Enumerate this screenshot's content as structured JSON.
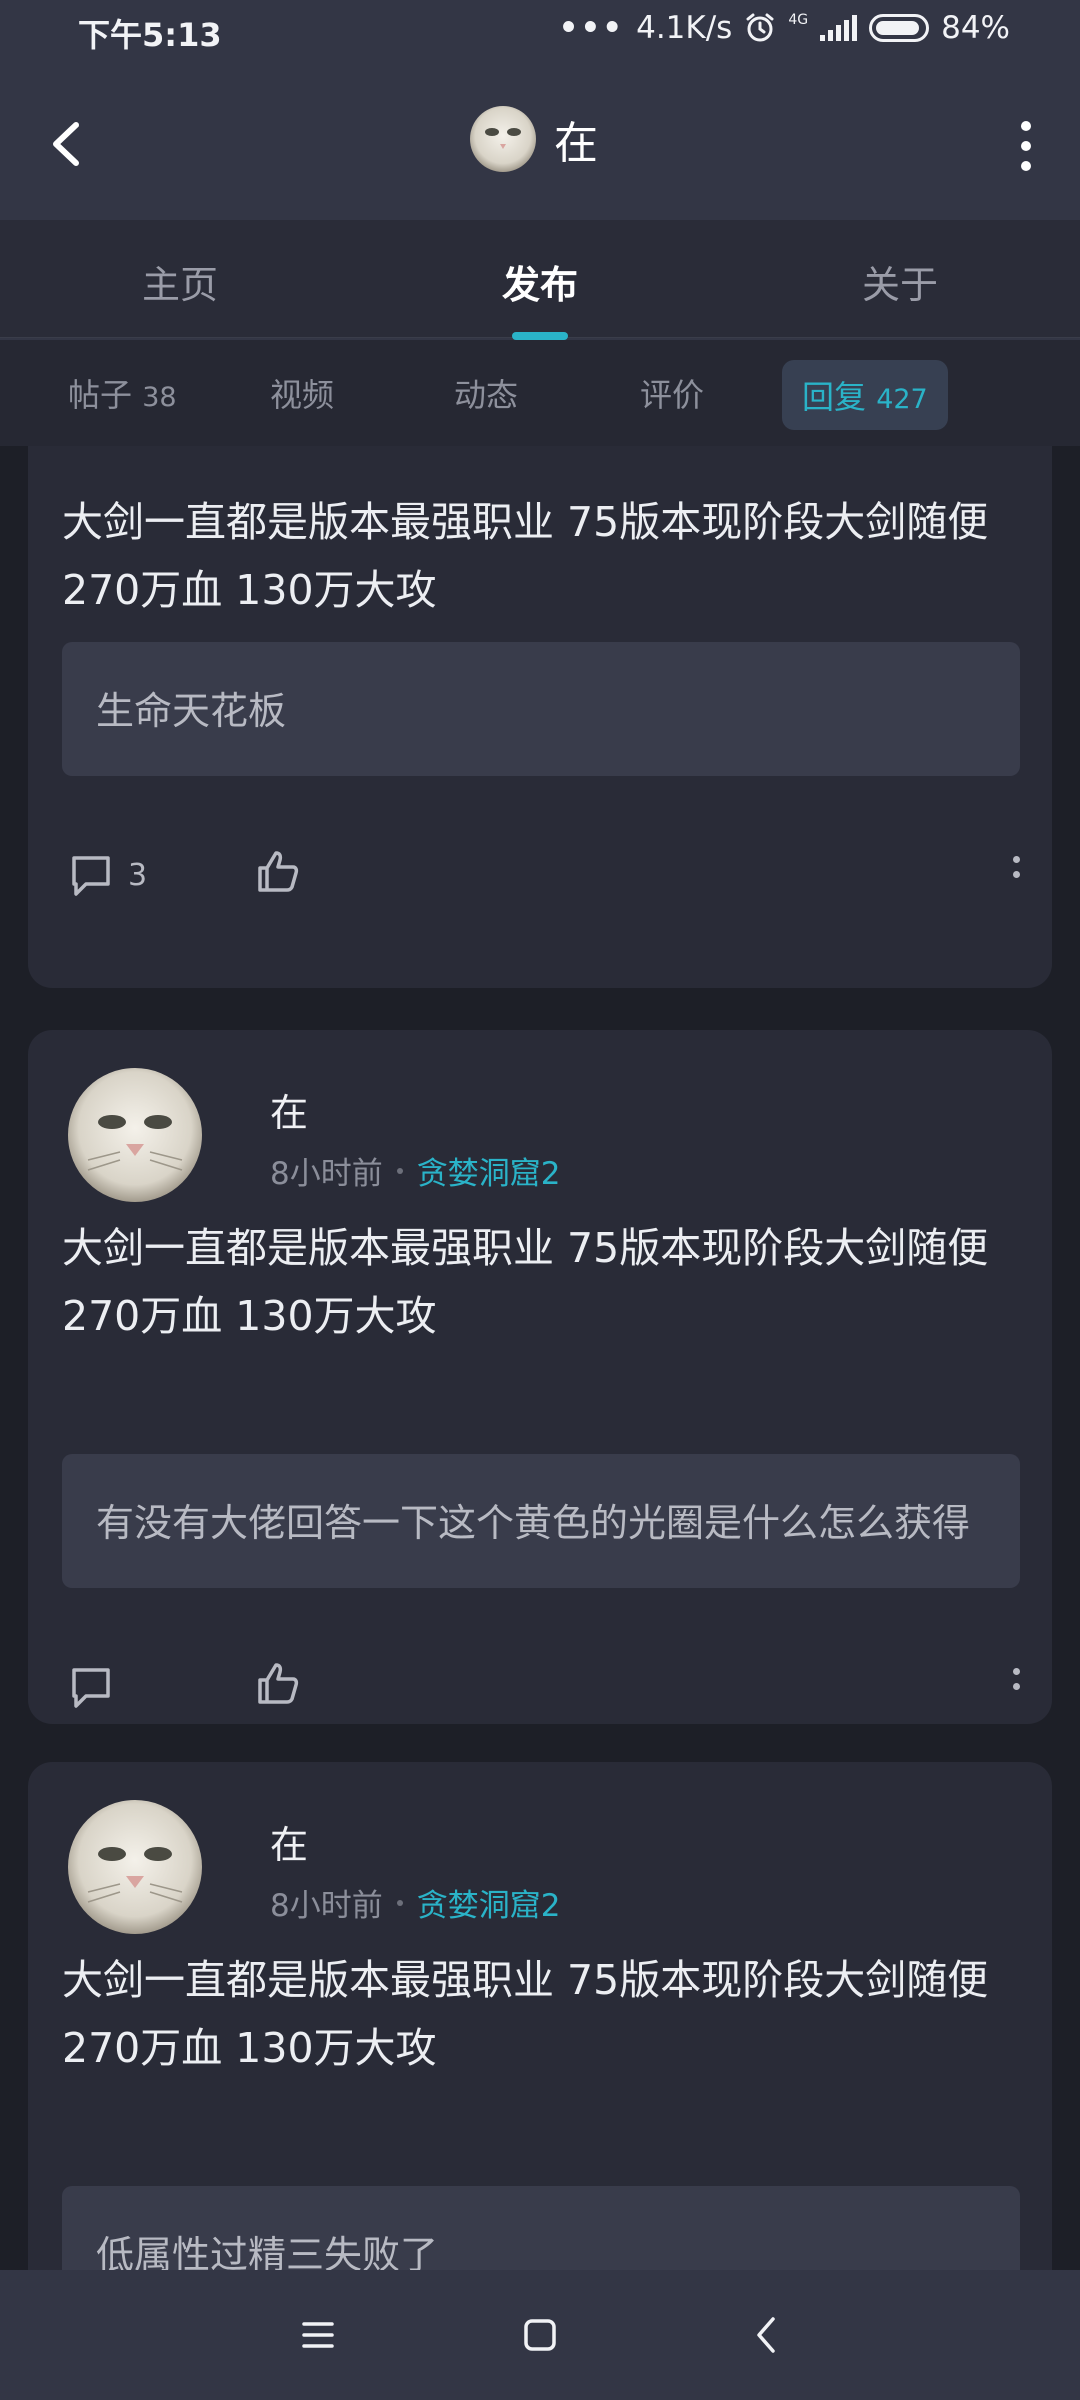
{
  "status_bar": {
    "time": "下午5:13",
    "net_speed": "4.1K/s",
    "network_type": "4G",
    "battery": "84%",
    "icons": [
      "alarm-icon",
      "signal-icon",
      "battery-icon"
    ]
  },
  "title_bar": {
    "title": "在",
    "icons": [
      "back-icon",
      "avatar",
      "more-vertical-icon"
    ]
  },
  "main_tabs": [
    {
      "label": "主页",
      "active": false
    },
    {
      "label": "发布",
      "active": true
    },
    {
      "label": "关于",
      "active": false
    }
  ],
  "sub_tabs": [
    {
      "label": "帖子",
      "count": "38",
      "active": false
    },
    {
      "label": "视频",
      "count": "",
      "active": false
    },
    {
      "label": "动态",
      "count": "",
      "active": false
    },
    {
      "label": "评价",
      "count": "",
      "active": false
    },
    {
      "label": "回复",
      "count": "427",
      "active": true
    }
  ],
  "posts": [
    {
      "text": "大剑一直都是版本最强职业 75版本现阶段大剑随便270万血 130万大攻",
      "quote": "生命天花板",
      "comment_count": "3"
    },
    {
      "author": "在",
      "time": "8小时前",
      "forum": "贪婪洞窟2",
      "text": "大剑一直都是版本最强职业 75版本现阶段大剑随便270万血 130万大攻",
      "quote": "有没有大佬回答一下这个黄色的光圈是什么怎么获得",
      "comment_count": ""
    },
    {
      "author": "在",
      "time": "8小时前",
      "forum": "贪婪洞窟2",
      "text": "大剑一直都是版本最强职业 75版本现阶段大剑随便270万血 130万大攻",
      "quote": "低属性过精三失败了",
      "comment_count": ""
    }
  ],
  "colors": {
    "accent": "#2ab3c8",
    "header_bg": "#333645",
    "card_bg": "#292b37",
    "page_bg": "#1d1f27",
    "quote_bg": "#393c4b"
  },
  "nav_bar": {
    "icons": [
      "menu-icon",
      "home-square-icon",
      "back-chevron-icon"
    ]
  }
}
